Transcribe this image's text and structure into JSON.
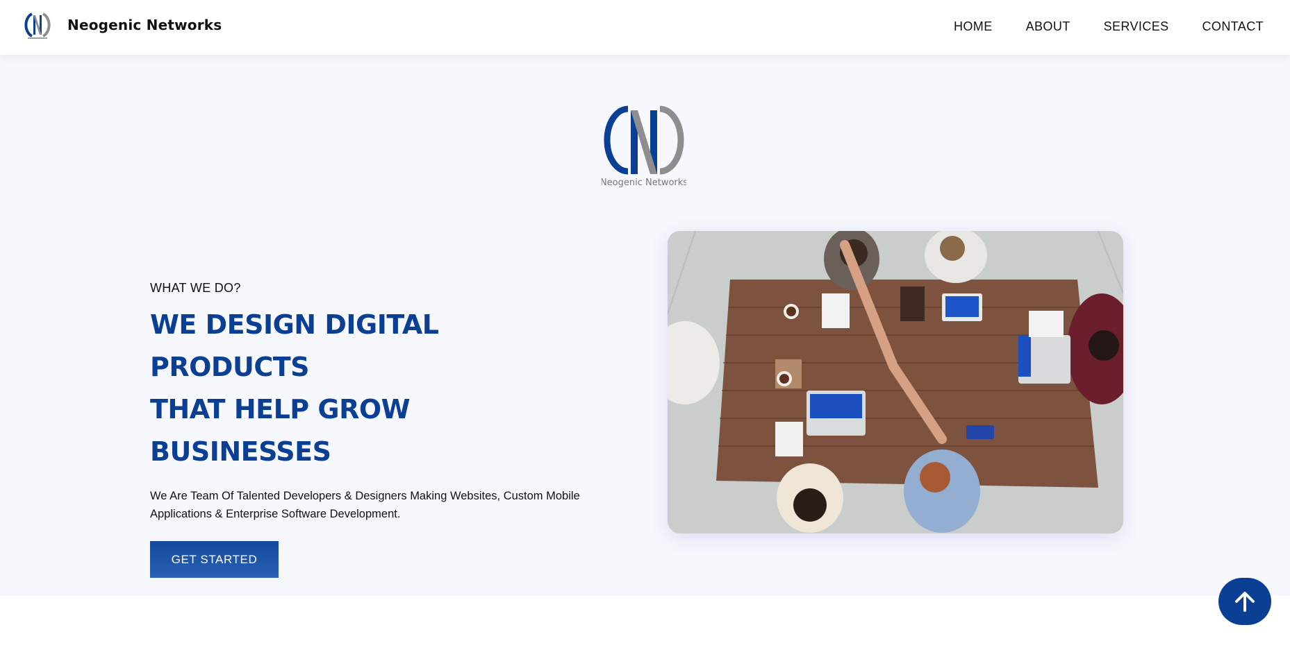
{
  "header": {
    "brand_name": "Neogenic Networks",
    "nav": [
      "HOME",
      "ABOUT",
      "SERVICES",
      "CONTACT"
    ]
  },
  "hero": {
    "logo_caption": "Neogenic Networks",
    "kicker": "WHAT WE DO?",
    "headline_line1": "WE DESIGN DIGITAL PRODUCTS",
    "headline_line2": "THAT HELP GROW BUSINESSES",
    "description": "We Are Team Of Talented Developers & Designers Making Websites, Custom Mobile Applications & Enterprise Software Development.",
    "cta_label": "GET STARTED"
  },
  "scroll_top": {
    "icon": "arrow-up-icon"
  },
  "colors": {
    "brand_blue": "#0a3f93",
    "logo_gray": "#8e8e8e",
    "hero_bg": "#f7f8fe"
  }
}
